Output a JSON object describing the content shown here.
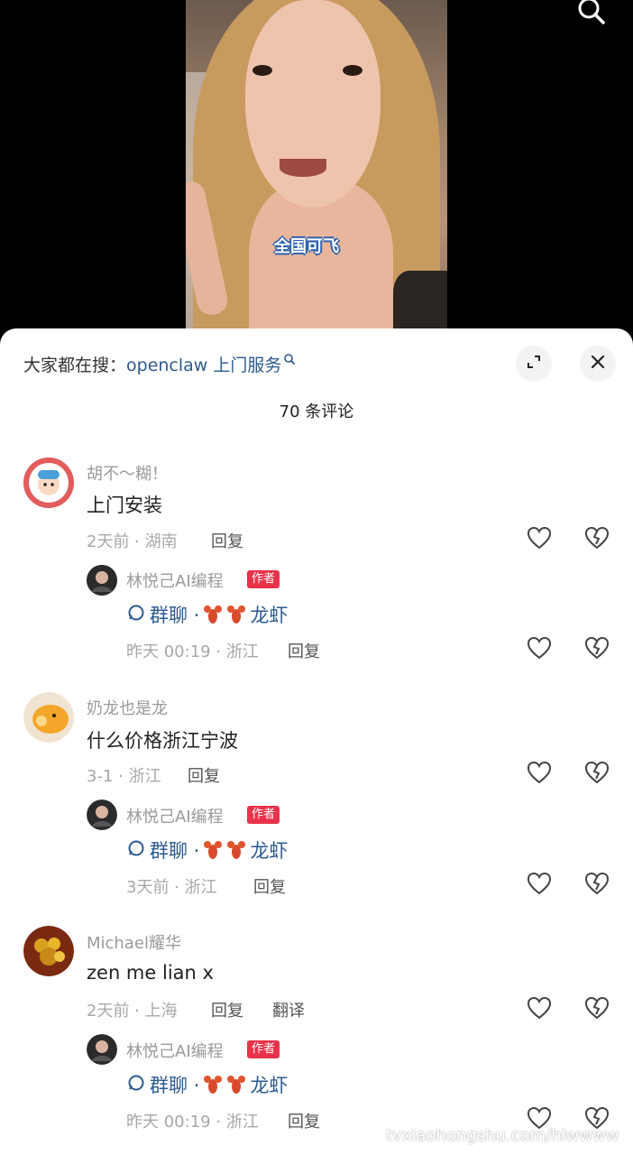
{
  "video": {
    "caption": "全国可飞"
  },
  "sheet": {
    "hot_search_prefix": "大家都在搜：",
    "hot_search_keyword": "openclaw 上门服务",
    "comment_count": "70 条评论"
  },
  "comments": [
    {
      "username": "胡不～糊！",
      "content": "上门安装",
      "meta": "2天前 · 湖南",
      "reply_label": "回复",
      "reply": {
        "username": "林悦己AI编程",
        "badge": "作者",
        "group_label": "群聊 ·",
        "group_name": "龙虾",
        "meta": "昨天 00:19 · 浙江",
        "reply_label": "回复"
      }
    },
    {
      "username": "奶龙也是龙",
      "content": "什么价格浙江宁波",
      "meta": "3-1 · 浙江",
      "reply_label": "回复",
      "reply": {
        "username": "林悦己AI编程",
        "badge": "作者",
        "group_label": "群聊 ·",
        "group_name": "龙虾",
        "meta": "3天前 · 浙江",
        "reply_label": "回复"
      }
    },
    {
      "username": "Michael耀华",
      "content": "zen me lian x",
      "meta": "2天前 · 上海",
      "reply_label": "回复",
      "translate_label": "翻译",
      "reply": {
        "username": "林悦己AI编程",
        "badge": "作者",
        "group_label": "群聊 ·",
        "group_name": "龙虾",
        "meta": "昨天 00:19 · 浙江",
        "reply_label": "回复"
      }
    }
  ],
  "watermark": "tvxiaohongshu.com/hlwwww",
  "colors": {
    "accent_link": "#2c5a8f",
    "badge": "#e8334a"
  },
  "icons": [
    "search-icon",
    "expand-icon",
    "close-icon",
    "heart-icon",
    "broken-heart-icon",
    "chat-bubble-icon",
    "lobster-icon"
  ]
}
